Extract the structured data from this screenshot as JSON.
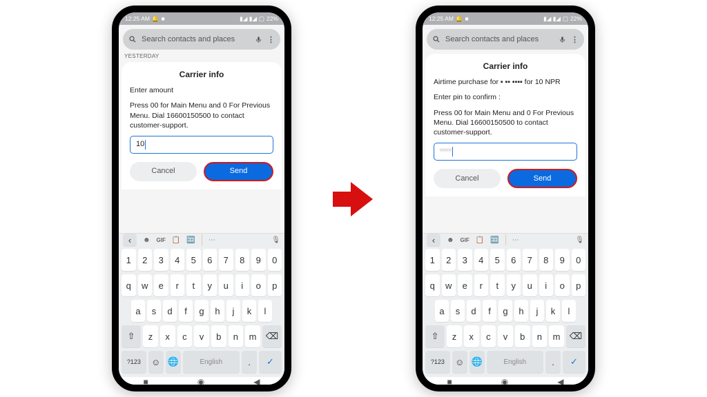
{
  "status": {
    "time": "12:25 AM",
    "battery": "22%"
  },
  "search": {
    "placeholder": "Search contacts and places"
  },
  "divider": "YESTERDAY",
  "dialog1": {
    "title": "Carrier info",
    "line1": "Enter amount",
    "line2": "Press  00 for Main Menu and 0 For Previous Menu. Dial 16600150500 to contact customer-support.",
    "input_value": "10",
    "cancel": "Cancel",
    "send": "Send"
  },
  "dialog2": {
    "title": "Carrier info",
    "line1": "Airtime  purchase for ▪  ▪▪ ▪▪▪▪ for 10 NPR",
    "line2": "Enter pin to confirm :",
    "line3": "Press  00 for Main Menu and 0 For Previous Menu. Dial 16600150500 to contact customer-support.",
    "input_placeholder": "****",
    "cancel": "Cancel",
    "send": "Send"
  },
  "keyboard": {
    "toolbar_gif": "GIF",
    "row_num": [
      "1",
      "2",
      "3",
      "4",
      "5",
      "6",
      "7",
      "8",
      "9",
      "0"
    ],
    "row1": [
      "q",
      "w",
      "e",
      "r",
      "t",
      "y",
      "u",
      "i",
      "o",
      "p"
    ],
    "row2": [
      "a",
      "s",
      "d",
      "f",
      "g",
      "h",
      "j",
      "k",
      "l"
    ],
    "row3": [
      "z",
      "x",
      "c",
      "v",
      "b",
      "n",
      "m"
    ],
    "sym": "?123",
    "space": "English"
  }
}
